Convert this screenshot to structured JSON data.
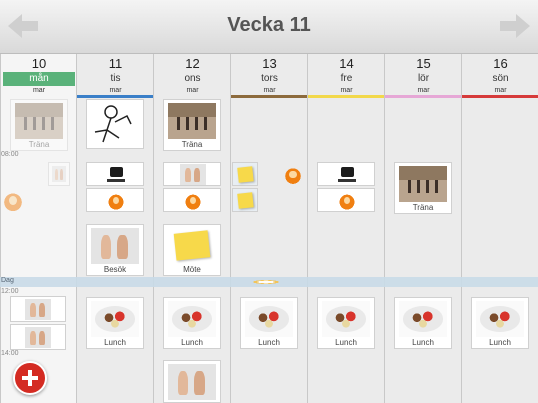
{
  "header": {
    "title": "Vecka 11",
    "prev_icon": "arrow-left-icon",
    "next_icon": "arrow-right-icon"
  },
  "days": [
    {
      "num": "10",
      "name": "mån",
      "month": "mar",
      "today": true
    },
    {
      "num": "11",
      "name": "tis",
      "month": "mar",
      "color": "#3a7fc8"
    },
    {
      "num": "12",
      "name": "ons",
      "month": "mar"
    },
    {
      "num": "13",
      "name": "tors",
      "month": "mar",
      "color": "#8c6a3c"
    },
    {
      "num": "14",
      "name": "fre",
      "month": "mar",
      "color": "#f2d84a"
    },
    {
      "num": "15",
      "name": "lör",
      "month": "mar",
      "color": "#e6a7d6"
    },
    {
      "num": "16",
      "name": "sön",
      "month": "mar",
      "color": "#d63a3a"
    }
  ],
  "times": {
    "t0800": "08:00",
    "t1200": "12:00",
    "t1400": "14:00"
  },
  "allday_label": "Dag",
  "labels": {
    "trana": "Träna",
    "besok": "Besök",
    "mote": "Möte",
    "lunch": "Lunch"
  },
  "colors": {
    "today_green": "#5ab27a",
    "add_red": "#d42b22",
    "allday_band": "#c9dbe8"
  },
  "add_button_icon": "plus-icon"
}
